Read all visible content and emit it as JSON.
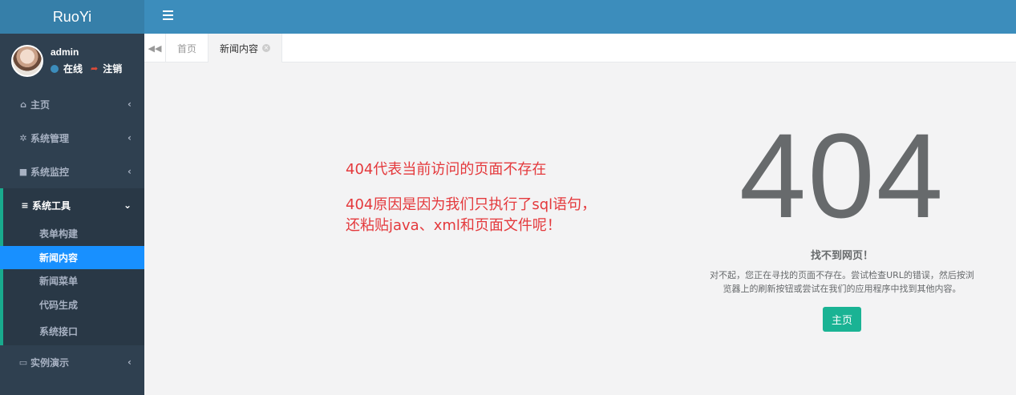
{
  "sidebar": {
    "brand": "RuoYi",
    "user": {
      "name": "admin",
      "status": "在线",
      "logout": "注销"
    },
    "items": [
      {
        "label": "主页",
        "icon": "home-icon",
        "glyph": "⌂",
        "chevron": "‹"
      },
      {
        "label": "系统管理",
        "icon": "gear-icon",
        "glyph": "✲",
        "chevron": "‹"
      },
      {
        "label": "系统监控",
        "icon": "video-camera-icon",
        "glyph": "■",
        "chevron": "‹"
      },
      {
        "label": "系统工具",
        "icon": "bars-icon",
        "glyph": "≡",
        "chevron": "⌄"
      },
      {
        "label": "实例演示",
        "icon": "desktop-icon",
        "glyph": "▭",
        "chevron": "‹"
      }
    ],
    "submenu": [
      "表单构建",
      "新闻内容",
      "新闻菜单",
      "代码生成",
      "系统接口"
    ]
  },
  "tabs": {
    "back": "◀◀",
    "items": [
      {
        "label": "首页"
      },
      {
        "label": "新闻内容",
        "close": "×"
      }
    ]
  },
  "main": {
    "note": {
      "line1": "404代表当前访问的页面不存在",
      "line2": "404原因是因为我们只执行了sql语句，",
      "line3": "还粘贴java、xml和页面文件呢！"
    },
    "error": {
      "code": "404",
      "title": "找不到网页！",
      "desc_line1": "对不起，您正在寻找的页面不存在。尝试检查URL的错误，然后按浏",
      "desc_line2": "览器上的刷新按钮或尝试在我们的应用程序中找到其他内容。",
      "button": "主页"
    }
  },
  "colors": {
    "sidebar_bg": "#2f4050",
    "topbar": "#3c8dbc",
    "active_item": "#1890ff",
    "note_text": "#e4393c",
    "home_button": "#1ab394"
  }
}
